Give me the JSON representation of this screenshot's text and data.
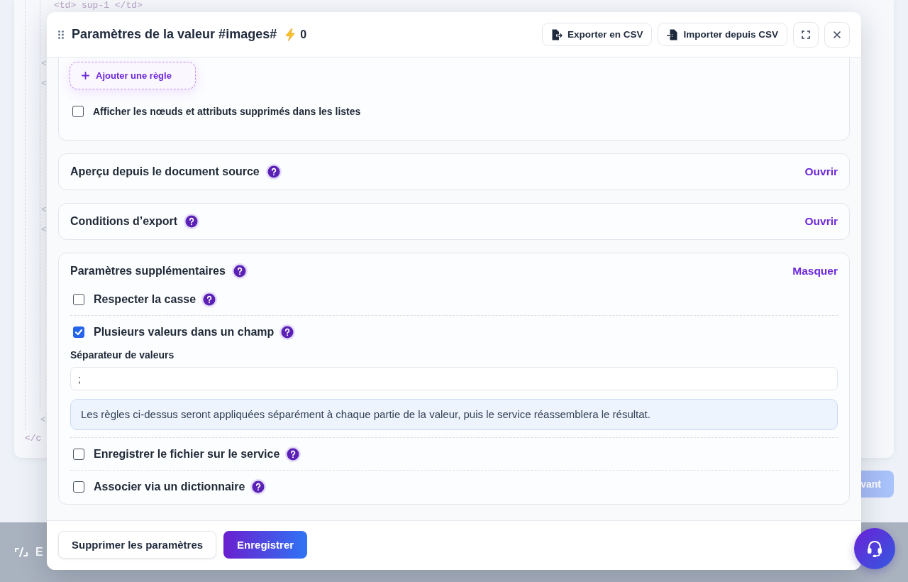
{
  "background": {
    "code_lines": [
      "<td> sup-1 </td>",
      "<",
      "<",
      "<",
      "<",
      "<",
      "</c"
    ],
    "next_button": "vant",
    "bottom_bar": {
      "label": "E"
    }
  },
  "dialog": {
    "title": "Paramètres de la valeur #images#",
    "counter": "0",
    "toolbar": [
      {
        "kind": "export",
        "label": "Exporter en CSV"
      },
      {
        "kind": "import",
        "label": "Importer depuis CSV"
      },
      {
        "kind": "fullscreen"
      },
      {
        "kind": "close"
      }
    ],
    "rules": {
      "add_button": "Ajouter une règle",
      "show_deleted": {
        "label": "Afficher les nœuds et attributs supprimés dans les listes",
        "checked": false
      }
    },
    "sections": [
      {
        "title": "Aperçu depuis le document source",
        "help": true,
        "toggle": "Ouvrir",
        "expanded": false
      },
      {
        "title": "Conditions d’export",
        "help": true,
        "toggle": "Ouvrir",
        "expanded": false
      },
      {
        "title": "Paramètres supplémentaires",
        "help": true,
        "toggle": "Masquer",
        "expanded": true,
        "items": [
          {
            "kind": "checkbox",
            "label": "Respecter la casse",
            "checked": false,
            "help": true
          },
          {
            "kind": "checkbox",
            "label": "Plusieurs valeurs dans un champ",
            "checked": true,
            "help": true
          },
          {
            "kind": "field",
            "label": "Séparateur de valeurs",
            "value": ";"
          },
          {
            "kind": "note",
            "text": "Les règles ci-dessus seront appliquées séparément à chaque partie de la valeur, puis le service réassemblera le résultat."
          },
          {
            "kind": "checkbox",
            "label": "Enregistrer le fichier sur le service",
            "checked": false,
            "help": true
          },
          {
            "kind": "checkbox",
            "label": "Associer via un dictionnaire",
            "checked": false,
            "help": true
          }
        ]
      }
    ],
    "footer_buttons": [
      {
        "kind": "secondary",
        "label": "Supprimer les paramètres"
      },
      {
        "kind": "primary",
        "label": "Enregistrer"
      }
    ]
  }
}
